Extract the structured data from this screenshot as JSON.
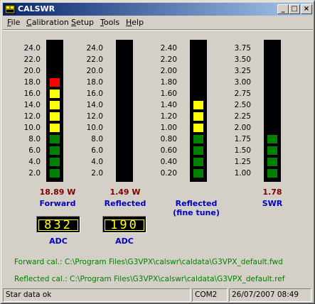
{
  "window": {
    "title": "CALSWR",
    "buttons": {
      "minimize": "_",
      "maximize": "□",
      "close": "×"
    }
  },
  "menu": [
    {
      "label": "File",
      "accel": "F"
    },
    {
      "label": "Calibration",
      "accel": "C"
    },
    {
      "label": "Setup",
      "accel": "S"
    },
    {
      "label": "Tools",
      "accel": "T"
    },
    {
      "label": "Help",
      "accel": "H"
    }
  ],
  "meters": [
    {
      "name": "Forward",
      "reading": "18.89 W",
      "scale": [
        "24.0",
        "22.0",
        "20.0",
        "18.0",
        "16.0",
        "14.0",
        "12.0",
        "10.0",
        "8.0",
        "6.0",
        "4.0",
        "2.0"
      ],
      "lit_segments": 9,
      "adc": "832",
      "adc_label": "ADC"
    },
    {
      "name": "Reflected",
      "reading": "1.49 W",
      "scale": [
        "24.0",
        "22.0",
        "20.0",
        "18.0",
        "16.0",
        "14.0",
        "12.0",
        "10.0",
        "8.0",
        "6.0",
        "4.0",
        "2.0"
      ],
      "lit_segments": 0,
      "adc": "190",
      "adc_label": "ADC"
    },
    {
      "name": "Reflected\n(fine tune)",
      "reading": "",
      "scale": [
        "2.40",
        "2.20",
        "2.00",
        "1.80",
        "1.60",
        "1.40",
        "1.20",
        "1.00",
        "0.80",
        "0.60",
        "0.40",
        "0.20"
      ],
      "lit_segments": 7
    },
    {
      "name": "SWR",
      "reading": "1.78",
      "scale": [
        "3.75",
        "3.50",
        "3.25",
        "3.00",
        "2.75",
        "2.50",
        "2.25",
        "2.00",
        "1.75",
        "1.50",
        "1.25",
        "1.00"
      ],
      "lit_segments": 4
    }
  ],
  "segment_colors": {
    "green": "#008000",
    "yellow": "#ffff00",
    "red": "#ff0000"
  },
  "calibration": {
    "forward": "Forward cal.: C:\\Program Files\\G3VPX\\calswr\\caldata\\G3VPX_default.fwd",
    "reflected": "Reflected cal.: C:\\Program Files\\G3VPX\\calswr\\caldata\\G3VPX_default.ref"
  },
  "status": {
    "message": "Star data ok",
    "port": "COM2",
    "datetime": "26/07/2007 08:49"
  }
}
